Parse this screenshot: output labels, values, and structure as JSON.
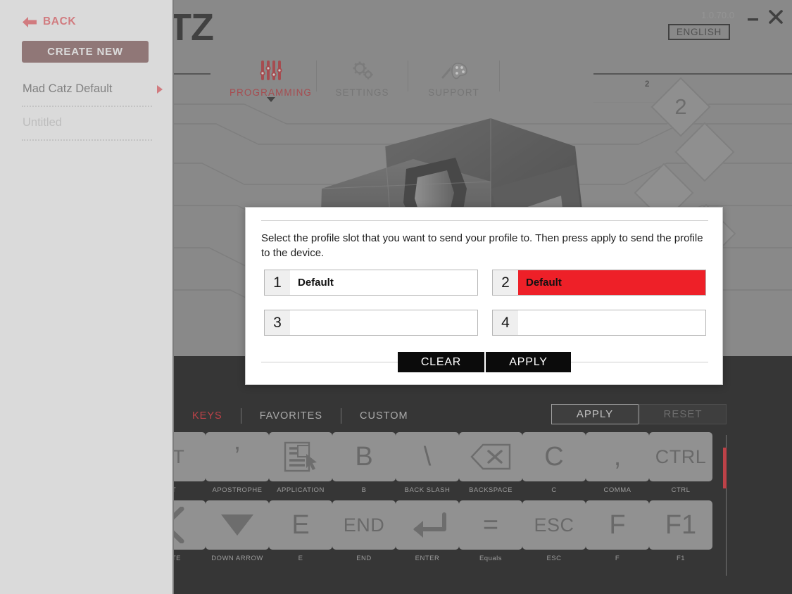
{
  "sidebar": {
    "back_label": "BACK",
    "back_icon": "arrow-left-icon",
    "create_new_label": "CREATE NEW",
    "profiles": [
      {
        "name": "Mad Catz Default",
        "muted": false,
        "has_caret": true
      },
      {
        "name": "Untitled",
        "muted": true,
        "has_caret": false
      }
    ]
  },
  "window": {
    "brand": "TZ",
    "version": "1.0.70.0",
    "language": "ENGLISH",
    "minimize_icon": "minimize-icon",
    "close_icon": "close-icon"
  },
  "topnav": {
    "items": [
      {
        "label": "PROGRAMMING",
        "icon": "sliders-icon",
        "active": true
      },
      {
        "label": "SETTINGS",
        "icon": "gears-icon",
        "active": false
      },
      {
        "label": "SUPPORT",
        "icon": "palette-icon",
        "active": false
      }
    ]
  },
  "device": {
    "callouts": [
      {
        "number": "2",
        "badge": "2"
      }
    ]
  },
  "keys_panel": {
    "tabs": [
      {
        "label": "KEYS",
        "active": true
      },
      {
        "label": "FAVORITES",
        "active": false
      },
      {
        "label": "CUSTOM",
        "active": false
      }
    ],
    "apply_label": "APPLY",
    "reset_label": "RESET",
    "keys": [
      {
        "glyph": "LT",
        "label": "T",
        "icon": "",
        "size": "small"
      },
      {
        "glyph": "’",
        "label": "APOSTROPHE",
        "icon": "",
        "size": "big"
      },
      {
        "glyph": "",
        "label": "APPLICATION",
        "icon": "application-icon",
        "size": "big"
      },
      {
        "glyph": "B",
        "label": "B",
        "icon": "",
        "size": "big"
      },
      {
        "glyph": "\\",
        "label": "BACK SLASH",
        "icon": "",
        "size": "big"
      },
      {
        "glyph": "",
        "label": "BACKSPACE",
        "icon": "backspace-icon",
        "size": "big"
      },
      {
        "glyph": "C",
        "label": "C",
        "icon": "",
        "size": "big"
      },
      {
        "glyph": ",",
        "label": "COMMA",
        "icon": "",
        "size": "big"
      },
      {
        "glyph": "CTRL",
        "label": "CTRL",
        "icon": "",
        "size": "small"
      },
      {
        "glyph": "",
        "label": "ETE",
        "icon": "left-arrow-icon",
        "size": "big"
      },
      {
        "glyph": "",
        "label": "DOWN ARROW",
        "icon": "down-arrow-icon",
        "size": "big"
      },
      {
        "glyph": "E",
        "label": "E",
        "icon": "",
        "size": "big"
      },
      {
        "glyph": "END",
        "label": "END",
        "icon": "",
        "size": "small"
      },
      {
        "glyph": "",
        "label": "ENTER",
        "icon": "enter-icon",
        "size": "big"
      },
      {
        "glyph": "=",
        "label": "Equals",
        "icon": "",
        "size": "big"
      },
      {
        "glyph": "ESC",
        "label": "ESC",
        "icon": "",
        "size": "small"
      },
      {
        "glyph": "F",
        "label": "F",
        "icon": "",
        "size": "big"
      },
      {
        "glyph": "F1",
        "label": "F1",
        "icon": "",
        "size": "big"
      }
    ]
  },
  "modal": {
    "message": "Select the profile slot that you want to send your profile to. Then press apply to send the profile to the device.",
    "slots": [
      {
        "number": "1",
        "name": "Default",
        "selected": false
      },
      {
        "number": "2",
        "name": "Default",
        "selected": true
      },
      {
        "number": "3",
        "name": "",
        "selected": false
      },
      {
        "number": "4",
        "name": "",
        "selected": false
      }
    ],
    "clear_label": "CLEAR",
    "apply_label": "APPLY"
  },
  "colors": {
    "accent_red": "#ee2028",
    "brand_red": "#e8151f",
    "dark_red": "#4a0d0d",
    "panel_gray": "#8f8f8f",
    "key_gray": "#9d9d9d"
  }
}
